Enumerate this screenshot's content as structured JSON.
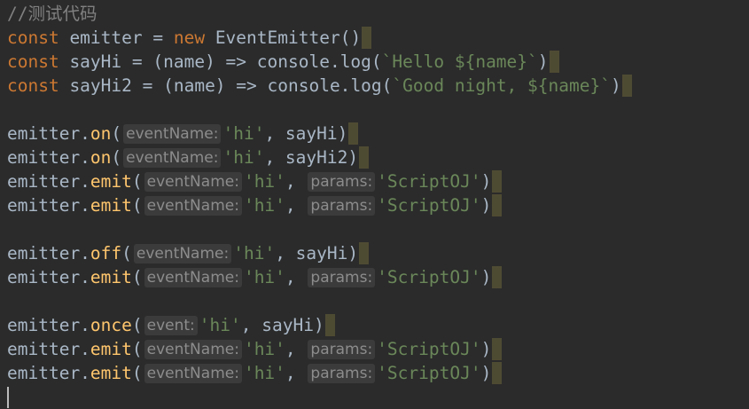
{
  "editor": {
    "comment": "//测试代码",
    "l2": {
      "kw": "const",
      "name": " emitter = ",
      "new": "new",
      "rest": " EventEmitter()"
    },
    "l3": {
      "kw": "const",
      "name": " sayHi = (name) => console.",
      "log": "log",
      "open": "(",
      "str": "`Hello ${name}`",
      "close": ")"
    },
    "l4": {
      "kw": "const",
      "name": " sayHi2 = (name) => console.",
      "log": "log",
      "open": "(",
      "str": "`Good night, ${name}`",
      "close": ")"
    },
    "emitter": "emitter.",
    "on": "on",
    "emit": "emit",
    "off": "off",
    "once": "once",
    "open": "(",
    "close": ")",
    "comma": ", ",
    "hint_eventName": "eventName:",
    "hint_params": "params:",
    "hint_event": "event:",
    "str_hi": "'hi'",
    "str_scriptoj": "'ScriptOJ'",
    "arg_sayHi": "sayHi",
    "arg_sayHi2": "sayHi2"
  }
}
